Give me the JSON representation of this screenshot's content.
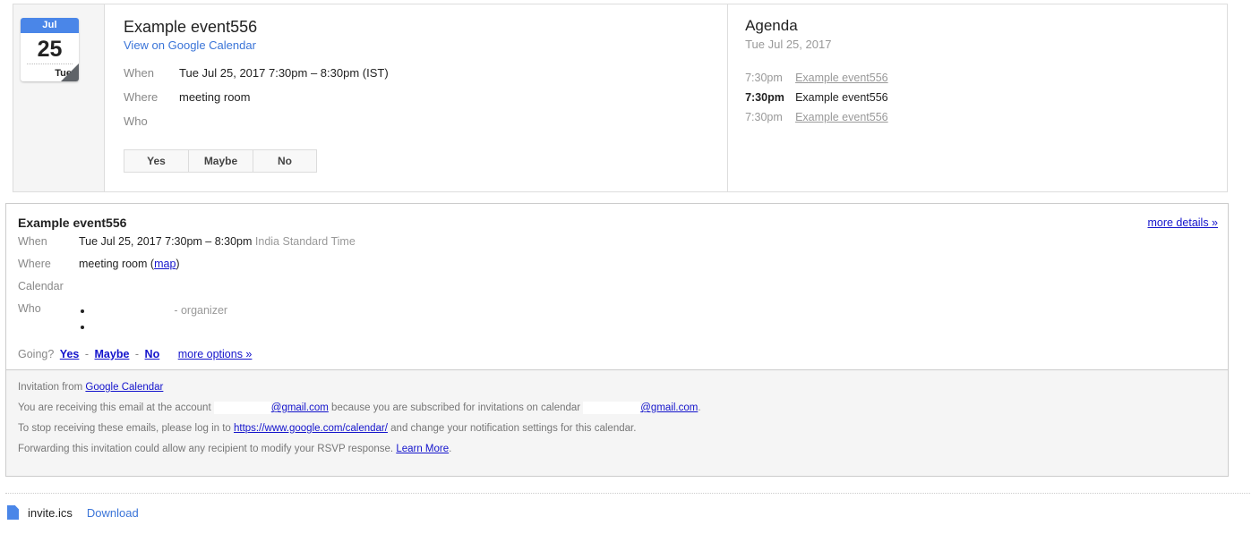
{
  "colors": {
    "accent_blue": "#4a86e8",
    "link_blue": "#3a74d8",
    "classic_link": "#1414cc",
    "muted_text": "#999999",
    "panel_bg": "#f5f5f5"
  },
  "summary_card": {
    "date_tile": {
      "month": "Jul",
      "day": "25",
      "weekday": "Tue"
    },
    "title": "Example event556",
    "view_link": "View on Google Calendar",
    "fields": [
      {
        "label": "When",
        "value": "Tue Jul 25, 2017 7:30pm – 8:30pm (IST)"
      },
      {
        "label": "Where",
        "value": "meeting room"
      },
      {
        "label": "Who",
        "value": ""
      }
    ],
    "rsvp_buttons": [
      "Yes",
      "Maybe",
      "No"
    ]
  },
  "agenda": {
    "heading": "Agenda",
    "date": "Tue Jul 25, 2017",
    "items": [
      {
        "time": "7:30pm",
        "name": "Example event556",
        "current": false
      },
      {
        "time": "7:30pm",
        "name": "Example event556",
        "current": true
      },
      {
        "time": "7:30pm",
        "name": "Example event556",
        "current": false
      }
    ]
  },
  "details": {
    "title": "Example event556",
    "more_details_link": "more details »",
    "when_label": "When",
    "when_value": "Tue Jul 25, 2017 7:30pm – 8:30pm",
    "when_timezone": "India Standard Time",
    "where_label": "Where",
    "where_value": "meeting room",
    "where_map_open": "(",
    "where_map_link": "map",
    "where_map_close": ")",
    "calendar_label": "Calendar",
    "calendar_value": "",
    "who_label": "Who",
    "who_entries": [
      {
        "name": "",
        "role": "- organizer"
      },
      {
        "name": "",
        "role": ""
      }
    ],
    "going_label": "Going?",
    "going_yes": "Yes",
    "going_sep1": "-",
    "going_maybe": "Maybe",
    "going_sep2": "-",
    "going_no": "No",
    "going_more": "more options »"
  },
  "footer": {
    "line1_pre": "Invitation from ",
    "line1_link": "Google Calendar",
    "line2_pre": "You are receiving this email at the account",
    "line2_link1": "@gmail.com",
    "line2_mid": "because you are subscribed for invitations on calendar",
    "line2_link2": "@gmail.com",
    "line2_end": ".",
    "line3_pre": "To stop receiving these emails, please log in to ",
    "line3_link": "https://www.google.com/calendar/",
    "line3_post": " and change your notification settings for this calendar.",
    "line4_pre": "Forwarding this invitation could allow any recipient to modify your RSVP response. ",
    "line4_link": "Learn More",
    "line4_post": "."
  },
  "attachment": {
    "filename": "invite.ics",
    "download_label": "Download"
  }
}
